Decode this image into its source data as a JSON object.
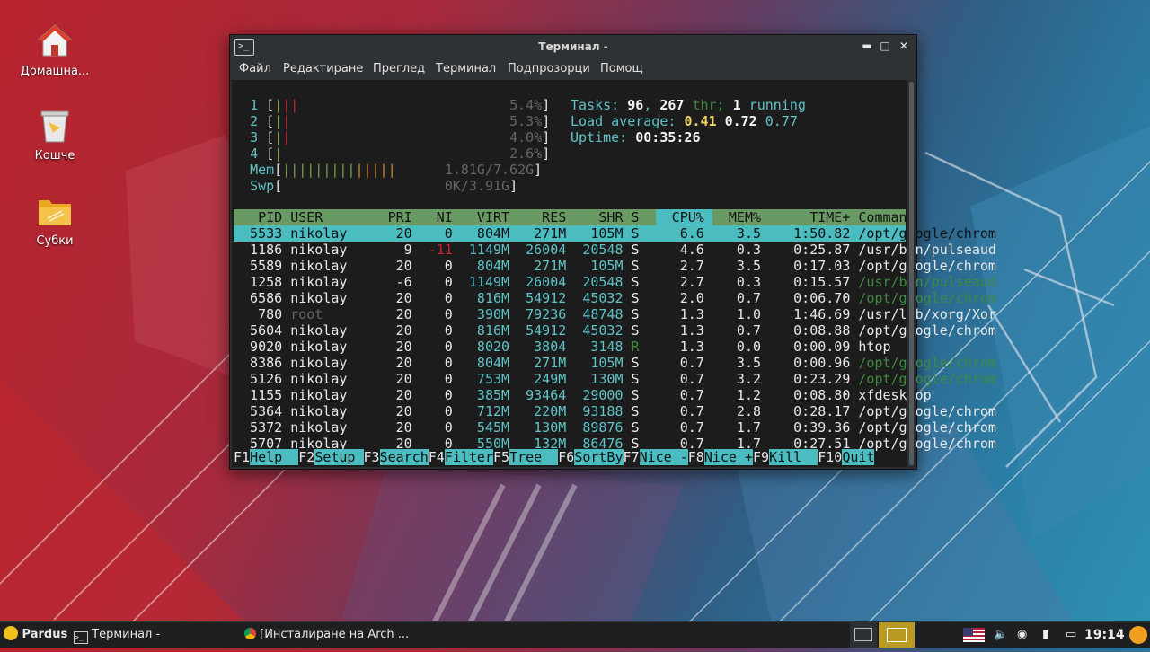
{
  "desktop": {
    "icons": [
      {
        "label": "Домашна..."
      },
      {
        "label": "Кошче"
      },
      {
        "label": "Субки"
      }
    ]
  },
  "window": {
    "title": "Терминал -",
    "menu": [
      "Файл",
      "Редактиране",
      "Преглед",
      "Терминал",
      "Подпрозорци",
      "Помощ"
    ]
  },
  "htop": {
    "cpus": [
      {
        "id": "1",
        "bar": "|||",
        "pct": "5.4%"
      },
      {
        "id": "2",
        "bar": "||",
        "pct": "5.3%"
      },
      {
        "id": "3",
        "bar": "||",
        "pct": "4.0%"
      },
      {
        "id": "4",
        "bar": "|",
        "pct": "2.6%"
      }
    ],
    "mem": {
      "label": "Mem",
      "bar": "||||||||||||||",
      "value": "1.81G/7.62G"
    },
    "swp": {
      "label": "Swp",
      "value": "0K/3.91G"
    },
    "tasks_label": "Tasks:",
    "tasks": "96",
    "thr": "267",
    "thr_label": "thr;",
    "running": "1",
    "running_label": "running",
    "load_label": "Load average:",
    "load1": "0.41",
    "load5": "0.72",
    "load15": "0.77",
    "uptime_label": "Uptime:",
    "uptime": "00:35:26",
    "columns": [
      "PID",
      "USER",
      "PRI",
      "NI",
      "VIRT",
      "RES",
      "SHR",
      "S",
      "CPU%",
      "MEM%",
      "TIME+",
      "Command"
    ],
    "rows": [
      [
        "5533",
        "nikolay",
        "20",
        "0",
        "804M",
        "271M",
        "105M",
        "S",
        "6.6",
        "3.5",
        "1:50.82",
        "/opt/google/chrom"
      ],
      [
        "1186",
        "nikolay",
        "9",
        "-11",
        "1149M",
        "26004",
        "20548",
        "S",
        "4.6",
        "0.3",
        "0:25.87",
        "/usr/bin/pulseaud"
      ],
      [
        "5589",
        "nikolay",
        "20",
        "0",
        "804M",
        "271M",
        "105M",
        "S",
        "2.7",
        "3.5",
        "0:17.03",
        "/opt/google/chrom"
      ],
      [
        "1258",
        "nikolay",
        "-6",
        "0",
        "1149M",
        "26004",
        "20548",
        "S",
        "2.7",
        "0.3",
        "0:15.57",
        "/usr/bin/pulseaud"
      ],
      [
        "6586",
        "nikolay",
        "20",
        "0",
        "816M",
        "54912",
        "45032",
        "S",
        "2.0",
        "0.7",
        "0:06.70",
        "/opt/google/chrom"
      ],
      [
        "780",
        "root",
        "20",
        "0",
        "390M",
        "79236",
        "48748",
        "S",
        "1.3",
        "1.0",
        "1:46.69",
        "/usr/lib/xorg/Xor"
      ],
      [
        "5604",
        "nikolay",
        "20",
        "0",
        "816M",
        "54912",
        "45032",
        "S",
        "1.3",
        "0.7",
        "0:08.88",
        "/opt/google/chrom"
      ],
      [
        "9020",
        "nikolay",
        "20",
        "0",
        "8020",
        "3804",
        "3148",
        "R",
        "1.3",
        "0.0",
        "0:00.09",
        "htop"
      ],
      [
        "8386",
        "nikolay",
        "20",
        "0",
        "804M",
        "271M",
        "105M",
        "S",
        "0.7",
        "3.5",
        "0:00.96",
        "/opt/google/chrom"
      ],
      [
        "5126",
        "nikolay",
        "20",
        "0",
        "753M",
        "249M",
        "130M",
        "S",
        "0.7",
        "3.2",
        "0:23.29",
        "/opt/google/chrom"
      ],
      [
        "1155",
        "nikolay",
        "20",
        "0",
        "385M",
        "93464",
        "29000",
        "S",
        "0.7",
        "1.2",
        "0:08.80",
        "xfdesktop"
      ],
      [
        "5364",
        "nikolay",
        "20",
        "0",
        "712M",
        "220M",
        "93188",
        "S",
        "0.7",
        "2.8",
        "0:28.17",
        "/opt/google/chrom"
      ],
      [
        "5372",
        "nikolay",
        "20",
        "0",
        "545M",
        "130M",
        "89876",
        "S",
        "0.7",
        "1.7",
        "0:39.36",
        "/opt/google/chrom"
      ],
      [
        "5707",
        "nikolay",
        "20",
        "0",
        "550M",
        "132M",
        "86476",
        "S",
        "0.7",
        "1.7",
        "0:27.51",
        "/opt/google/chrom"
      ]
    ],
    "fkeys": [
      {
        "k": "F1",
        "l": "Help  "
      },
      {
        "k": "F2",
        "l": "Setup "
      },
      {
        "k": "F3",
        "l": "Search"
      },
      {
        "k": "F4",
        "l": "Filter"
      },
      {
        "k": "F5",
        "l": "Tree  "
      },
      {
        "k": "F6",
        "l": "SortBy"
      },
      {
        "k": "F7",
        "l": "Nice -"
      },
      {
        "k": "F8",
        "l": "Nice +"
      },
      {
        "k": "F9",
        "l": "Kill  "
      },
      {
        "k": "F10",
        "l": "Quit"
      }
    ]
  },
  "taskbar": {
    "start": "Pardus",
    "items": [
      "Терминал -",
      "[Инсталиране на Arch ..."
    ],
    "clock": "19:14"
  },
  "colors": {
    "accent": "#4bbcc0",
    "header": "#6a9a64",
    "terminal_bg": "#1c1c1c"
  }
}
